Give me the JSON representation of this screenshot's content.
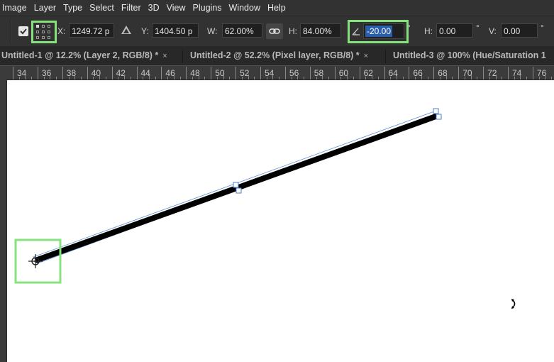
{
  "menubar": {
    "items": [
      "Image",
      "Layer",
      "Type",
      "Select",
      "Filter",
      "3D",
      "View",
      "Plugins",
      "Window",
      "Help"
    ]
  },
  "options": {
    "x_label": "X:",
    "x_value": "1249.72 p",
    "y_label": "Y:",
    "y_value": "1404.50 p",
    "w_label": "W:",
    "w_value": "62.00%",
    "h_label": "H:",
    "h_value": "84.00%",
    "angle_value": "-20.00",
    "degree_symbol": "°",
    "skew_h_label": "H:",
    "skew_h_value": "0.00",
    "skew_v_label": "V:",
    "skew_v_value": "0.00"
  },
  "tabs": [
    {
      "label": "Untitled-1 @ 12.2% (Layer 2, RGB/8) *",
      "close": "×"
    },
    {
      "label": "Untitled-2 @ 52.2% (Pixel layer, RGB/8) *",
      "close": "×"
    },
    {
      "label": "Untitled-3 @ 100% (Hue/Saturation 1",
      "close": ""
    }
  ],
  "ruler": {
    "labels": [
      "34",
      "36",
      "38",
      "40",
      "42",
      "44",
      "46",
      "48",
      "50",
      "52",
      "54",
      "56",
      "58",
      "60",
      "62",
      "64",
      "66",
      "68",
      "70",
      "72",
      "74",
      "76"
    ]
  },
  "colors": {
    "highlight": "#86e27c",
    "selection": "#2a5ea8",
    "line": "#000000",
    "bounding_box": "#5b8fd6"
  },
  "icons": {
    "commit": "checkmark-icon",
    "reference_point": "reference-point-grid-icon",
    "relative": "delta-icon",
    "link": "chain-link-icon",
    "angle": "angle-icon",
    "pivot": "crosshair-pivot-icon",
    "cursor": "rotate-cursor-icon"
  }
}
